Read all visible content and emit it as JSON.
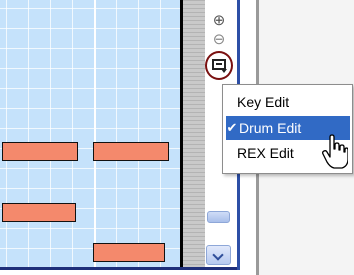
{
  "edit_menu": {
    "items": [
      {
        "label": "Key Edit",
        "checked": false
      },
      {
        "label": "Drum Edit",
        "checked": true
      },
      {
        "label": "REX Edit",
        "checked": false
      }
    ],
    "check_glyph": "✔"
  },
  "toolbar": {
    "zoom_in_icon": "⊕",
    "zoom_out_icon": "⊖",
    "edit_mode_button_icon": "edit-mode-icon"
  },
  "colors": {
    "grid_background": "#c5e2fb",
    "note_fill": "#f4896c",
    "menu_selection": "#316ac5",
    "highlight_ring": "#7a1010"
  }
}
